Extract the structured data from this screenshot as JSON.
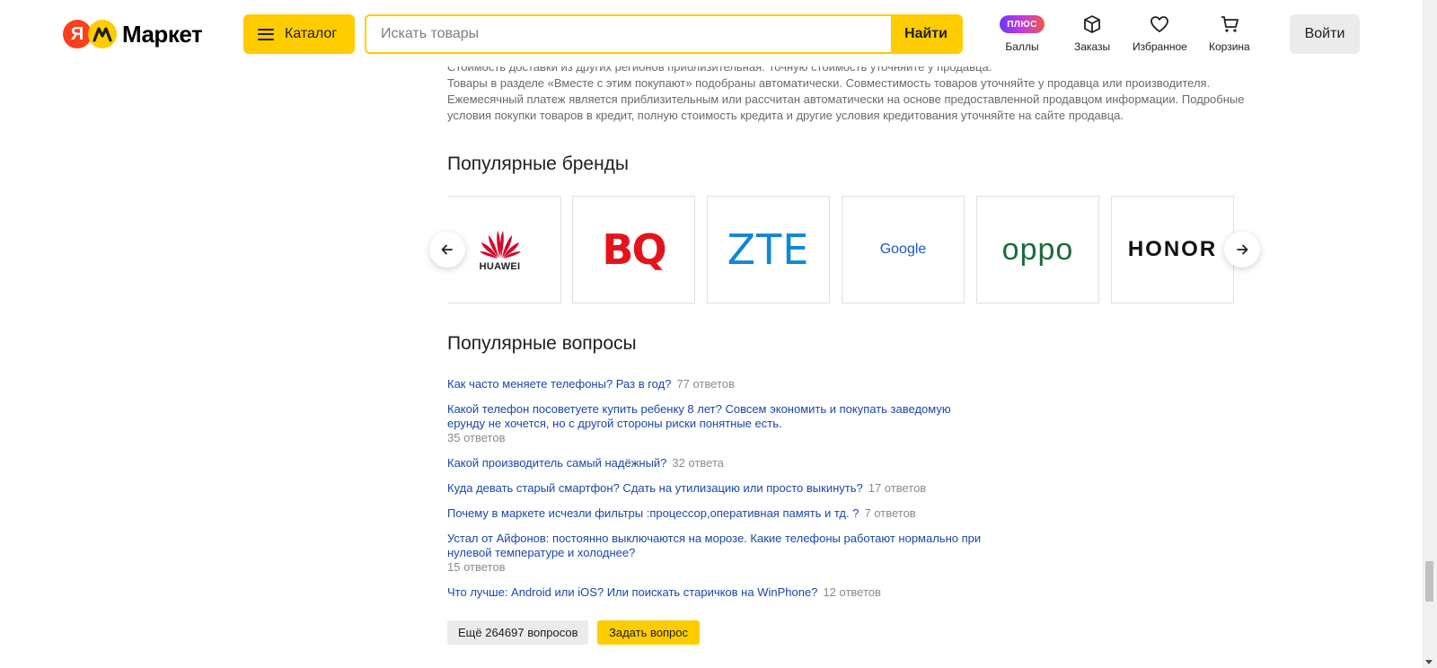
{
  "header": {
    "logo_letter": "Я",
    "logo_text": "Маркет",
    "catalog_label": "Каталог",
    "search_placeholder": "Искать товары",
    "search_button": "Найти",
    "plus_badge": "ПЛЮС",
    "nav": [
      {
        "label": "Баллы",
        "icon": "plus-icon"
      },
      {
        "label": "Заказы",
        "icon": "box-icon"
      },
      {
        "label": "Избранное",
        "icon": "heart-icon"
      },
      {
        "label": "Корзина",
        "icon": "cart-icon"
      }
    ],
    "login_label": "Войти"
  },
  "disclaimer": {
    "line1": "Стоимость доставки из других регионов приблизительная. Точную стоимость уточняйте у продавца.",
    "line2": "Товары в разделе «Вместе с этим покупают» подобраны автоматически. Совместимость товаров уточняйте у продавца или производителя.",
    "line3": "Ежемесячный платеж является приблизительным или рассчитан автоматически на основе предоставленной продавцом информации. Подробные условия покупки товаров в кредит, полную стоимость кредита и другие условия кредитования уточняйте на сайте продавца."
  },
  "brands": {
    "title": "Популярные бренды",
    "items": [
      "HUAWEI",
      "BQ",
      "ZTE",
      "Google",
      "oppo",
      "HONOR"
    ]
  },
  "questions": {
    "title": "Популярные вопросы",
    "items": [
      {
        "text": "Как часто меняете телефоны? Раз в год?",
        "count": "77 ответов"
      },
      {
        "text": "Какой телефон посоветуете купить ребенку 8 лет? Совсем экономить и покупать заведомую ерунду не хочется, но с другой стороны риски понятные есть.",
        "count": "35 ответов"
      },
      {
        "text": "Какой производитель самый надёжный?",
        "count": "32 ответа"
      },
      {
        "text": "Куда девать старый смартфон? Сдать на утилизацию или просто выкинуть?",
        "count": "17 ответов"
      },
      {
        "text": "Почему в маркете исчезли фильтры :процессор,оперативная память и тд. ?",
        "count": "7 ответов"
      },
      {
        "text": "Устал от Айфонов: постоянно выключаются на морозе. Какие телефоны работают нормально при нулевой температуре и холоднее?",
        "count": "15 ответов"
      },
      {
        "text": "Что лучше: Android или iOS? Или поискать старичков на WinPhone?",
        "count": "12 ответов"
      }
    ],
    "more_label": "Ещё 264697 вопросов",
    "ask_label": "Задать вопрос"
  },
  "colors": {
    "accent": "#ffcc00",
    "link": "#1a47a8",
    "brand_red": "#fc3f1d"
  }
}
